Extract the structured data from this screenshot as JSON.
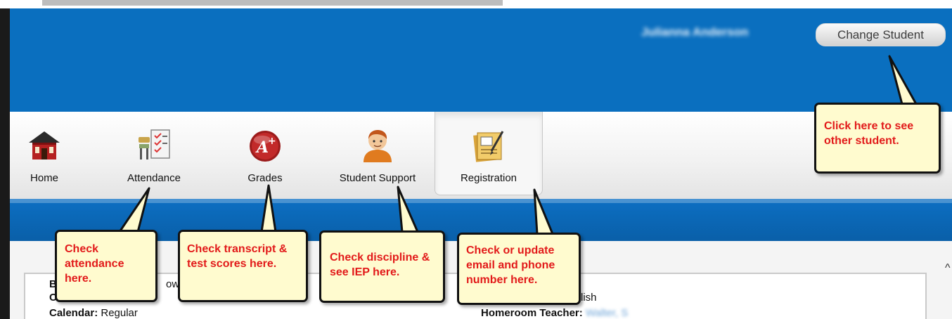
{
  "header": {
    "student_name": "Julianna Anderson",
    "change_student_label": "Change Student"
  },
  "nav": {
    "items": [
      {
        "label": "Home",
        "icon": "home-icon"
      },
      {
        "label": "Attendance",
        "icon": "attendance-icon"
      },
      {
        "label": "Grades",
        "icon": "grades-icon"
      },
      {
        "label": "Student Support",
        "icon": "student-support-icon"
      },
      {
        "label": "Registration",
        "icon": "registration-icon",
        "active": true
      }
    ]
  },
  "callouts": {
    "change_student": "Click here to see other student.",
    "attendance": "Check attendance here.",
    "grades": "Check transcript & test scores here.",
    "student_support": "Check discipline & see IEP here.",
    "registration": "Check or update email and phone number here."
  },
  "profile": {
    "calendar_label": "Calendar:",
    "calendar_value": "Regular",
    "homeroom_label": "Homeroom Teacher:",
    "homeroom_value": "Walter, S",
    "partial_left_1": "B",
    "partial_left_2": "C",
    "partial_mid": "owe",
    "partial_right": "lish"
  },
  "colors": {
    "header_blue": "#0a6fbf",
    "callout_fill": "#fffbcf",
    "callout_text": "#e21a1a"
  }
}
